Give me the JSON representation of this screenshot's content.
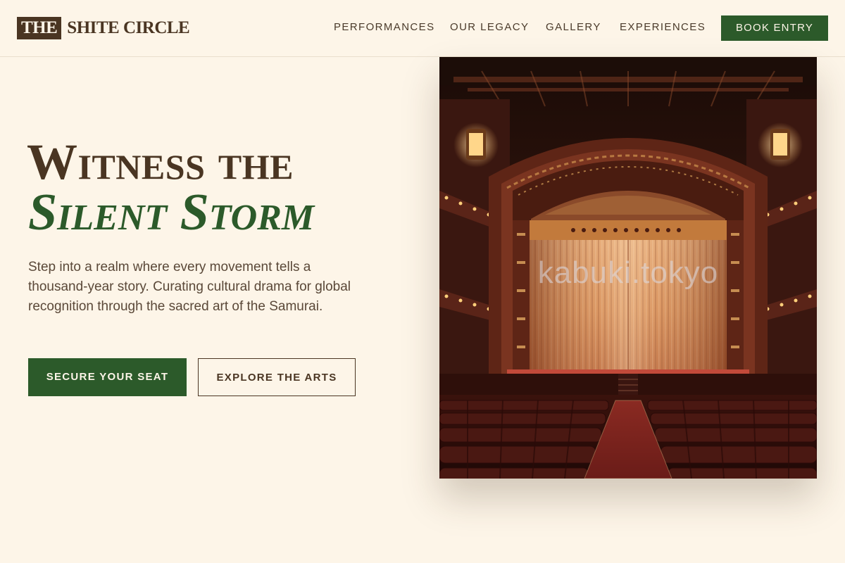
{
  "brand": {
    "mark": "THE",
    "name": "SHITE CIRCLE"
  },
  "nav": {
    "items": [
      "PERFORMANCES",
      "OUR LEGACY",
      "GALLERY",
      "EXPERIENCES"
    ],
    "cta": "BOOK ENTRY"
  },
  "hero": {
    "title_line1": "Witness the",
    "title_line2": "Silent Storm",
    "description": "Step into a realm where every movement tells a thousand-year story. Curating cultural drama for global recognition through the sacred art of the Samurai.",
    "primary_cta": "SECURE YOUR SEAT",
    "secondary_cta": "EXPLORE THE ARTS",
    "image_watermark": "kabuki.tokyo"
  },
  "colors": {
    "background": "#fdf5e8",
    "brown": "#4a3522",
    "green": "#2c5a2a"
  },
  "icons": {
    "hero_image": "theater-stage-interior"
  }
}
